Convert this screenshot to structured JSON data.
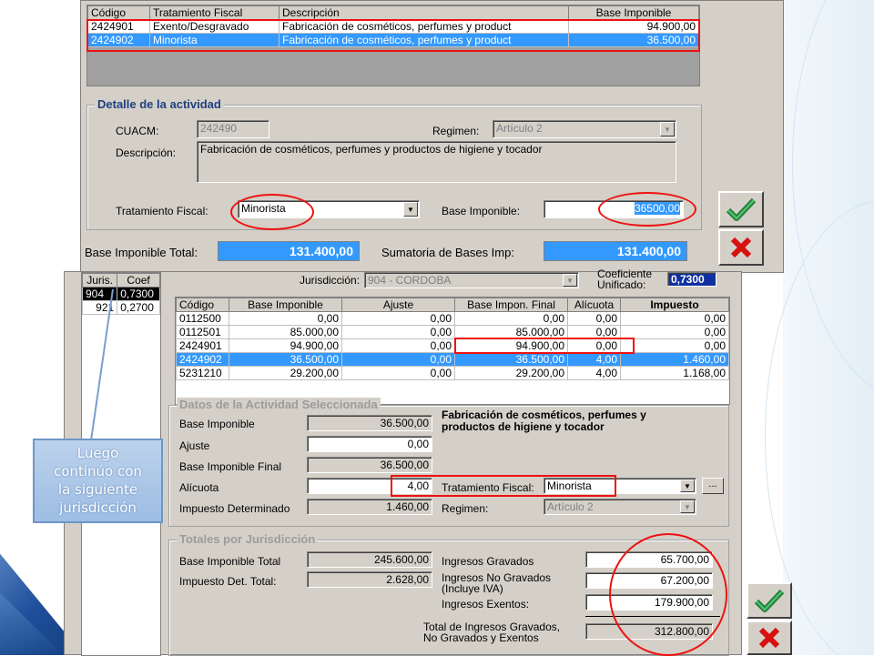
{
  "top": {
    "grid_headers": [
      "Código",
      "Tratamiento Fiscal",
      "Descripción",
      "Base Imponible"
    ],
    "grid_rows": [
      {
        "codigo": "2424901",
        "tratamiento": "Exento/Desgravado",
        "descripcion": "Fabricación de cosméticos, perfumes y product",
        "base": "94.900,00"
      },
      {
        "codigo": "2424902",
        "tratamiento": "Minorista",
        "descripcion": "Fabricación de cosméticos, perfumes y product",
        "base": "36.500,00"
      }
    ],
    "detalle_legend": "Detalle de la actividad",
    "cuacm_label": "CUACM:",
    "cuacm_value": "242490",
    "regimen_label": "Regimen:",
    "regimen_value": "Artículo 2",
    "descripcion_label": "Descripción:",
    "descripcion_value": "Fabricación de cosméticos, perfumes y productos de higiene y tocador",
    "tratamiento_label": "Tratamiento Fiscal:",
    "tratamiento_value": "Minorista",
    "base_label": "Base Imponible:",
    "base_value": "36500,00",
    "base_total_label": "Base Imponible Total:",
    "base_total_value": "131.400,00",
    "sumatoria_label": "Sumatoria de Bases Imp:",
    "sumatoria_value": "131.400,00"
  },
  "bottom": {
    "juris_headers": [
      "Juris.",
      "Coef"
    ],
    "juris_rows": [
      {
        "juris": "904",
        "coef": "0,7300"
      },
      {
        "juris": "921",
        "coef": "0,2700"
      }
    ],
    "jurisdiccion_label": "Jurisdicción:",
    "jurisdiccion_value": "904 - CORDOBA",
    "coeficiente_label_1": "Coeficiente",
    "coeficiente_label_2": "Unificado:",
    "coeficiente_value": "0,7300",
    "grid_headers": [
      "Código",
      "Base Imponible",
      "Ajuste",
      "Base Impon. Final",
      "Alícuota",
      "Impuesto"
    ],
    "grid_rows": [
      {
        "codigo": "0112500",
        "base": "0,00",
        "ajuste": "0,00",
        "final": "0,00",
        "alicuota": "0,00",
        "impuesto": "0,00"
      },
      {
        "codigo": "0112501",
        "base": "85.000,00",
        "ajuste": "0,00",
        "final": "85.000,00",
        "alicuota": "0,00",
        "impuesto": "0,00"
      },
      {
        "codigo": "2424901",
        "base": "94.900,00",
        "ajuste": "0,00",
        "final": "94.900,00",
        "alicuota": "0,00",
        "impuesto": "0,00"
      },
      {
        "codigo": "2424902",
        "base": "36.500,00",
        "ajuste": "0,00",
        "final": "36.500,00",
        "alicuota": "4,00",
        "impuesto": "1.460,00"
      },
      {
        "codigo": "5231210",
        "base": "29.200,00",
        "ajuste": "0,00",
        "final": "29.200,00",
        "alicuota": "4,00",
        "impuesto": "1.168,00"
      }
    ],
    "datos_legend": "Datos de la Actividad Seleccionada",
    "base_imponible_label": "Base Imponible",
    "base_imponible_value": "36.500,00",
    "ajuste_label": "Ajuste",
    "ajuste_value": "0,00",
    "base_final_label": "Base Imponible Final",
    "base_final_value": "36.500,00",
    "alicuota_label": "Alícuota",
    "alicuota_value": "4,00",
    "impuesto_det_label": "Impuesto Determinado",
    "impuesto_det_value": "1.460,00",
    "actividad_desc_1": "Fabricación de cosméticos, perfumes y",
    "actividad_desc_2": "productos de higiene y tocador",
    "tratamiento_label": "Tratamiento Fiscal:",
    "tratamiento_value": "Minorista",
    "ellipsis_label": "...",
    "regimen_label": "Regimen:",
    "regimen_value": "Artículo 2",
    "totales_legend": "Totales por Jurisdicción",
    "base_total_label": "Base Imponible Total",
    "base_total_value": "245.600,00",
    "impuesto_total_label": "Impuesto Det. Total:",
    "impuesto_total_value": "2.628,00",
    "ingresos_gravados_label": "Ingresos Gravados",
    "ingresos_gravados_value": "65.700,00",
    "ingresos_no_gravados_label_1": "Ingresos No Gravados",
    "ingresos_no_gravados_label_2": "(Incluye IVA)",
    "ingresos_no_gravados_value": "67.200,00",
    "ingresos_exentos_label": "Ingresos Exentos:",
    "ingresos_exentos_value": "179.900,00",
    "total_ingresos_label_1": "Total de Ingresos Gravados,",
    "total_ingresos_label_2": "No Gravados y Exentos",
    "total_ingresos_value": "312.800,00"
  },
  "callout": {
    "line1": "Luego",
    "line2": "continúo con",
    "line3": "la siguiente",
    "line4": "jurisdicción"
  },
  "icons": {
    "ok": "checkmark-icon",
    "cancel": "red-x-icon"
  }
}
